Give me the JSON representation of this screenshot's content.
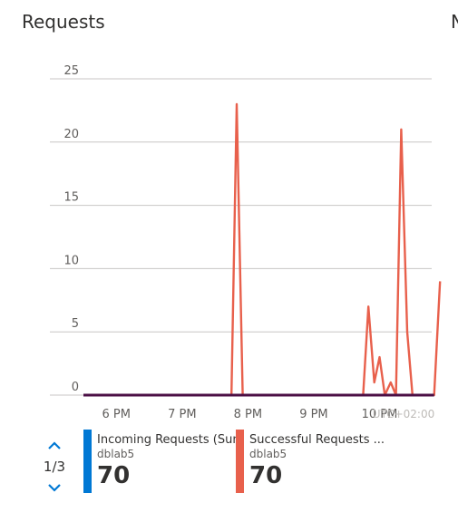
{
  "tile": {
    "title": "Requests",
    "clipped_next_title": "N"
  },
  "legend": {
    "pager": "1/3",
    "items": [
      {
        "name": "Incoming Requests (Sum",
        "resource": "dblab5",
        "value": "70",
        "color": "#0078d4"
      },
      {
        "name": "Successful Requests ...",
        "resource": "dblab5",
        "value": "70",
        "color": "#e8604c"
      }
    ]
  },
  "icons": {
    "up": "chevron-up-icon",
    "down": "chevron-down-icon"
  },
  "chart_data": {
    "type": "line",
    "title": "Requests",
    "xlabel": "",
    "ylabel": "",
    "ylim": [
      0,
      25
    ],
    "yticks": [
      0,
      5,
      10,
      15,
      20,
      25
    ],
    "xlim": [
      17.5,
      22.2
    ],
    "xticks": [
      {
        "v": 18,
        "label": "6 PM"
      },
      {
        "v": 19,
        "label": "7 PM"
      },
      {
        "v": 20,
        "label": "8 PM"
      },
      {
        "v": 21,
        "label": "9 PM"
      },
      {
        "v": 22,
        "label": "10 PM"
      }
    ],
    "timezone_label": "UTC+02:00",
    "grid": true,
    "series": [
      {
        "name": "Successful Requests",
        "color": "#e8604c",
        "x": [
          17.5,
          19.75,
          19.83,
          19.92,
          21.75,
          21.83,
          21.92,
          22.0,
          22.08,
          22.17,
          22.25,
          22.33,
          22.42,
          22.5,
          22.58,
          22.67,
          22.75,
          22.83,
          22.92
        ],
        "y": [
          0,
          0,
          23,
          0,
          0,
          7,
          1,
          3,
          0,
          1,
          0,
          21,
          5,
          0,
          0,
          0,
          0,
          0,
          9
        ]
      },
      {
        "name": "Incoming Requests",
        "color": "#4b0f45",
        "x": [
          17.5,
          22.83
        ],
        "y": [
          0,
          0
        ]
      }
    ]
  }
}
